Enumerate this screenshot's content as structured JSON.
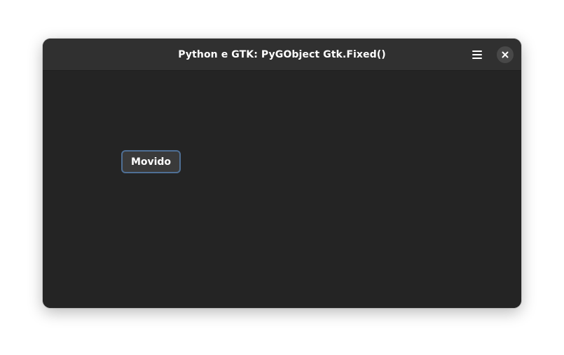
{
  "window": {
    "title": "Python e GTK: PyGObject Gtk.Fixed()"
  },
  "headerbar": {
    "menu_icon": "hamburger-menu-icon",
    "close_icon": "close-icon"
  },
  "content": {
    "button_label": "Movido"
  },
  "colors": {
    "window_bg": "#242424",
    "headerbar_bg": "#303030",
    "focus_ring": "#4f6f94",
    "button_bg": "#3a3a3a",
    "text": "#ffffff"
  }
}
